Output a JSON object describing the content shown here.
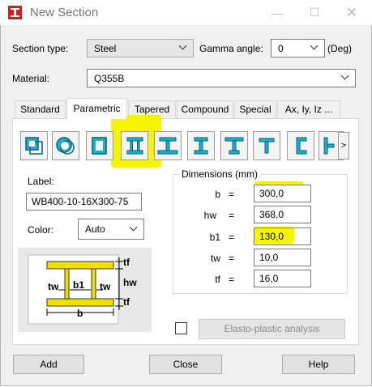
{
  "window": {
    "title": "New Section",
    "minimize_icon": "minimize-icon",
    "maximize_icon": "maximize-icon",
    "close_icon": "close-icon"
  },
  "section_type": {
    "label": "Section type:",
    "value": "Steel"
  },
  "gamma": {
    "label": "Gamma angle:",
    "value": "0",
    "unit": "(Deg)"
  },
  "material": {
    "label": "Material:",
    "value": "Q355B"
  },
  "tabs": [
    {
      "label": "Standard"
    },
    {
      "label": "Parametric",
      "active": true
    },
    {
      "label": "Tapered"
    },
    {
      "label": "Compound"
    },
    {
      "label": "Special"
    },
    {
      "label": "Ax, Iy, Iz ..."
    }
  ],
  "shape_buttons": [
    "box-section-icon",
    "circular-section-icon",
    "rectangle-section-icon",
    "i-section-icon",
    "i-section-variant-icon",
    "narrow-i-section-icon",
    "t-i-section-icon",
    "t-section-icon",
    "channel-section-icon",
    "more-sections-icon"
  ],
  "scroll_right": ">",
  "label_field": {
    "label": "Label:",
    "value": "WB400-10-16X300-75"
  },
  "color": {
    "label": "Color:",
    "value": "Auto"
  },
  "diagram": {
    "tf_top": "tf",
    "hw": "hw",
    "tf_bottom": "tf",
    "tw_left": "tw",
    "b1": "b1",
    "tw_right": "tw",
    "b": "b"
  },
  "dimensions": {
    "title": "Dimensions (mm)",
    "rows": [
      {
        "name": "b",
        "eq": "=",
        "value": "300,0"
      },
      {
        "name": "hw",
        "eq": "=",
        "value": "368,0"
      },
      {
        "name": "b1",
        "eq": "=",
        "value": "130,0"
      },
      {
        "name": "tw",
        "eq": "=",
        "value": "10,0"
      },
      {
        "name": "tf",
        "eq": "=",
        "value": "16,0"
      }
    ]
  },
  "elasto_plastic": {
    "label": "Elasto-plastic analysis",
    "checked": false
  },
  "buttons": {
    "add": "Add",
    "close": "Close",
    "help": "Help"
  },
  "colors": {
    "highlight": "#f5f500",
    "section_fill": "#f0e000"
  }
}
